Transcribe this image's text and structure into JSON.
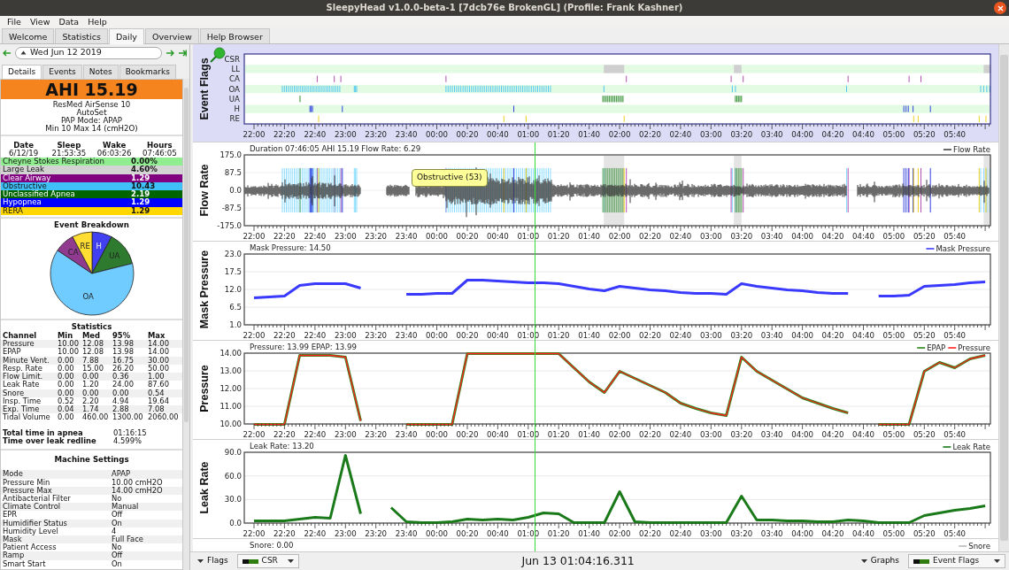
{
  "window": {
    "title": "SleepyHead v1.0.0-beta-1 [7dcb76e BrokenGL] (Profile: Frank Kashner)"
  },
  "menu": [
    "File",
    "View",
    "Data",
    "Help"
  ],
  "tabs": [
    {
      "label": "Welcome",
      "selected": false
    },
    {
      "label": "Statistics",
      "selected": false
    },
    {
      "label": "Daily",
      "selected": true
    },
    {
      "label": "Overview",
      "selected": false
    },
    {
      "label": "Help Browser",
      "selected": false
    }
  ],
  "day_nav": {
    "date": "Wed Jun 12 2019"
  },
  "detail_tabs": [
    {
      "label": "Details",
      "selected": true
    },
    {
      "label": "Events",
      "selected": false
    },
    {
      "label": "Notes",
      "selected": false
    },
    {
      "label": "Bookmarks",
      "selected": false
    }
  ],
  "summary": {
    "ahi": "AHI 15.19",
    "lines": [
      "ResMed AirSense 10",
      "AutoSet",
      "PAP Mode: APAP",
      "Min 10 Max 14 (cmH2O)"
    ]
  },
  "session": {
    "columns": [
      "Date",
      "Sleep",
      "Wake",
      "Hours"
    ],
    "values": [
      "6/12/19",
      "21:53:35",
      "06:03:26",
      "07:46:05"
    ]
  },
  "indices": [
    {
      "name": "Cheyne Stokes Respiration",
      "value": "0.00%",
      "color": "#90ee90"
    },
    {
      "name": "Large Leak",
      "value": "4.60%",
      "color": "#d3d3d3"
    },
    {
      "name": "Clear Airway",
      "value": "1.29",
      "color": "#800080"
    },
    {
      "name": "Obstructive",
      "value": "10.43",
      "color": "#40c0f8"
    },
    {
      "name": "Unclassified Apnea",
      "value": "2.19",
      "color": "#006400"
    },
    {
      "name": "Hypopnea",
      "value": "1.29",
      "color": "#0000ff"
    },
    {
      "name": "RERA",
      "value": "1.29",
      "color": "#ffd700"
    }
  ],
  "breakdown": {
    "title": "Event Breakdown",
    "slices": [
      {
        "label": "H",
        "color": "#4040f0"
      },
      {
        "label": "UA",
        "color": "#2e7a2e"
      },
      {
        "label": "OA",
        "color": "#70ccff"
      },
      {
        "label": "CA",
        "color": "#903a90"
      },
      {
        "label": "RE",
        "color": "#ffdd33"
      }
    ]
  },
  "statistics": {
    "title": "Statistics",
    "columns": [
      "Channel",
      "Min",
      "Med",
      "95%",
      "Max"
    ],
    "rows": [
      [
        "Pressure",
        "10.00",
        "12.08",
        "13.98",
        "14.00"
      ],
      [
        "EPAP",
        "10.00",
        "12.08",
        "13.98",
        "14.00"
      ],
      [
        "Minute Vent.",
        "0.00",
        "7.88",
        "16.75",
        "30.00"
      ],
      [
        "Resp. Rate",
        "0.00",
        "15.00",
        "26.20",
        "50.00"
      ],
      [
        "Flow Limit.",
        "0.00",
        "0.00",
        "0.36",
        "1.00"
      ],
      [
        "Leak Rate",
        "0.00",
        "1.20",
        "24.00",
        "87.60"
      ],
      [
        "Snore",
        "0.00",
        "0.00",
        "0.00",
        "0.54"
      ],
      [
        "Insp. Time",
        "0.52",
        "2.20",
        "4.94",
        "19.64"
      ],
      [
        "Exp. Time",
        "0.04",
        "1.74",
        "2.88",
        "7.08"
      ],
      [
        "Tidal Volume",
        "0.00",
        "460.00",
        "1300.00",
        "2060.00"
      ]
    ]
  },
  "totals": [
    {
      "label": "Total time in apnea",
      "value": "01:16:15"
    },
    {
      "label": "Time over leak redline",
      "value": "4.599%"
    }
  ],
  "machine_settings": {
    "title": "Machine Settings",
    "rows": [
      [
        "Mode",
        "APAP"
      ],
      [
        "Pressure Min",
        "10.00 cmH2O"
      ],
      [
        "Pressure Max",
        "14.00 cmH2O"
      ],
      [
        "Antibacterial Filter",
        "No"
      ],
      [
        "Climate Control",
        "Manual"
      ],
      [
        "EPR",
        "Off"
      ],
      [
        "Humidifier Status",
        "On"
      ],
      [
        "Humidity Level",
        "4"
      ],
      [
        "Mask",
        "Full Face"
      ],
      [
        "Patient Access",
        "No"
      ],
      [
        "Ramp",
        "Off"
      ],
      [
        "Smart Start",
        "On"
      ]
    ]
  },
  "graphs": [
    {
      "kind": "flags",
      "title": "Event Flags",
      "rows": [
        "CSR",
        "LL",
        "CA",
        "OA",
        "UA",
        "H",
        "RE"
      ],
      "time_ticks": [
        "22:00",
        "22:20",
        "22:40",
        "23:00",
        "23:20",
        "23:40",
        "00:00",
        "00:20",
        "00:40",
        "01:00",
        "01:20",
        "01:40",
        "02:00",
        "02:20",
        "02:40",
        "03:00",
        "03:20",
        "03:40",
        "04:00",
        "04:20",
        "04:40",
        "05:00",
        "05:20",
        "05:40"
      ]
    },
    {
      "kind": "waveform",
      "title": "Flow Rate",
      "readout": "Duration 07:46:05 AHI 15.19 Flow Rate: 6.29",
      "legend": [
        "Flow Rate"
      ],
      "tooltip": "Obstructive (53)",
      "y_labels": [
        "175.0",
        "87.5",
        "0.0",
        "-87.5",
        "-175.0"
      ],
      "time_ticks": [
        "22:00",
        "22:20",
        "22:40",
        "23:00",
        "23:20",
        "23:40",
        "00:00",
        "00:20",
        "00:40",
        "01:00",
        "01:20",
        "01:40",
        "02:00",
        "02:20",
        "02:40",
        "03:00",
        "03:20",
        "03:40",
        "04:00",
        "04:20",
        "04:40",
        "05:00",
        "05:20",
        "05:40"
      ]
    },
    {
      "kind": "line",
      "readout": "Mask Pressure: 14.50",
      "chart_data": {
        "type": "line",
        "ylabel": "Mask Pressure",
        "ylim": [
          1,
          23
        ],
        "grid": true,
        "legend": "upper right",
        "yticks": [
          {
            "value": 1,
            "label": "1.0"
          },
          {
            "value": 6.5,
            "label": "6.5"
          },
          {
            "value": 12,
            "label": "12.0"
          },
          {
            "value": 17.5,
            "label": "17.5"
          },
          {
            "value": 23,
            "label": "23.0"
          }
        ],
        "categories": [
          "22:00",
          null,
          "22:20",
          null,
          "22:40",
          null,
          "23:00",
          null,
          "23:20",
          null,
          "23:40",
          null,
          "00:00",
          null,
          "00:20",
          null,
          "00:40",
          null,
          "01:00",
          null,
          "01:20",
          null,
          "01:40",
          null,
          "02:00",
          null,
          "02:20",
          null,
          "02:40",
          null,
          "03:00",
          null,
          "03:20",
          null,
          "03:40",
          null,
          "04:00",
          null,
          "04:20",
          null,
          "04:40",
          null,
          "05:00",
          null,
          "05:20",
          null,
          "05:40",
          null,
          null
        ],
        "series": [
          {
            "name": "Mask Pressure",
            "color": "#3a3aff",
            "values": [
              9.5,
              9.8,
              10,
              13.5,
              13.8,
              14,
              13.8,
              12.5,
              null,
              null,
              10.5,
              10.6,
              10.8,
              11,
              15,
              15,
              14.8,
              14.5,
              14.3,
              14.3,
              14,
              13,
              12.3,
              11.8,
              13,
              12.5,
              12,
              11.6,
              11.2,
              11,
              10.8,
              10.6,
              14,
              13,
              12.5,
              12,
              11.6,
              11.3,
              11,
              10.8,
              null,
              10,
              10.2,
              10.3,
              13,
              13.5,
              13.6,
              14.2,
              14.5
            ]
          }
        ]
      }
    },
    {
      "kind": "line",
      "readout": "Pressure: 13.99 EPAP: 13.99",
      "chart_data": {
        "type": "line",
        "ylabel": "Pressure",
        "ylim": [
          10,
          14
        ],
        "grid": true,
        "legend": "upper right",
        "yticks": [
          {
            "value": 10,
            "label": "10.00"
          },
          {
            "value": 11,
            "label": "11.00"
          },
          {
            "value": 12,
            "label": "12.00"
          },
          {
            "value": 13,
            "label": "13.00"
          },
          {
            "value": 14,
            "label": "14.00"
          }
        ],
        "categories": [
          "22:00",
          null,
          "22:20",
          null,
          "22:40",
          null,
          "23:00",
          null,
          "23:20",
          null,
          "23:40",
          null,
          "00:00",
          null,
          "00:20",
          null,
          "00:40",
          null,
          "01:00",
          null,
          "01:20",
          null,
          "01:40",
          null,
          "02:00",
          null,
          "02:20",
          null,
          "02:40",
          null,
          "03:00",
          null,
          "03:20",
          null,
          "03:40",
          null,
          "04:00",
          null,
          "04:20",
          null,
          "04:40",
          null,
          "05:00",
          null,
          "05:20",
          null,
          "05:40",
          null,
          null
        ],
        "series": [
          {
            "name": "EPAP",
            "color": "#2a8a1a",
            "values": [
              10,
              10,
              10,
              13.9,
              13.9,
              13.9,
              13.8,
              10.2,
              null,
              null,
              10,
              10,
              10,
              10,
              14,
              14,
              14,
              14,
              14,
              14,
              14,
              13.2,
              12.4,
              11.8,
              13,
              12.6,
              12.2,
              11.8,
              11.2,
              10.9,
              10.65,
              10.5,
              13.8,
              13,
              12.5,
              12,
              11.5,
              11.2,
              10.9,
              10.65,
              null,
              10,
              10,
              10,
              13,
              13.5,
              13.2,
              13.7,
              13.9
            ]
          },
          {
            "name": "Pressure",
            "color": "#ff2020",
            "values": [
              10,
              10,
              10,
              13.9,
              13.9,
              13.9,
              13.8,
              10.2,
              null,
              null,
              10,
              10,
              10,
              10,
              14,
              14,
              14,
              14,
              14,
              14,
              14,
              13.2,
              12.4,
              11.8,
              13,
              12.6,
              12.2,
              11.8,
              11.2,
              10.9,
              10.65,
              10.5,
              13.8,
              13,
              12.5,
              12,
              11.5,
              11.2,
              10.9,
              10.65,
              null,
              10,
              10,
              10,
              13,
              13.5,
              13.2,
              13.7,
              13.9
            ]
          }
        ]
      }
    },
    {
      "kind": "line",
      "readout": "Leak Rate: 13.20",
      "chart_data": {
        "type": "line",
        "ylabel": "Leak Rate",
        "ylim": [
          0,
          90
        ],
        "grid": true,
        "legend": "upper right",
        "yticks": [
          {
            "value": 0,
            "label": "0.0"
          },
          {
            "value": 30,
            "label": "30.0"
          },
          {
            "value": 60,
            "label": "60.0"
          },
          {
            "value": 90,
            "label": "90.0"
          }
        ],
        "categories": [
          "22:00",
          null,
          "22:20",
          null,
          "22:40",
          null,
          "23:00",
          null,
          "23:20",
          null,
          "23:40",
          null,
          "00:00",
          null,
          "00:20",
          null,
          "00:40",
          null,
          "01:00",
          null,
          "01:20",
          null,
          "01:40",
          null,
          "02:00",
          null,
          "02:20",
          null,
          "02:40",
          null,
          "03:00",
          null,
          "03:20",
          null,
          "03:40",
          null,
          "04:00",
          null,
          "04:20",
          null,
          "04:40",
          null,
          "05:00",
          null,
          "05:20",
          null,
          "05:40",
          null,
          null
        ],
        "series": [
          {
            "name": "Leak Rate",
            "color": "#1a7a1a",
            "values": [
              3,
              3,
              3,
              6,
              8,
              7,
              87,
              12,
              null,
              20,
              2,
              1,
              1,
              2,
              6,
              5,
              6,
              4,
              8,
              14,
              12,
              1,
              1,
              1,
              40,
              2,
              1,
              1,
              1,
              1,
              1,
              1,
              35,
              5,
              4,
              3,
              3,
              2,
              2,
              5,
              3,
              1,
              1,
              1,
              10,
              14,
              17,
              19,
              22
            ]
          }
        ]
      }
    },
    {
      "kind": "strip",
      "readout": "Snore: 0.00",
      "legend": [
        "Snore"
      ]
    }
  ],
  "bottom_bar": {
    "flags_button": "Flags",
    "flag_select": "CSR",
    "position": "Jun 13 01:04:16.311",
    "graphs_button": "Graphs",
    "graph_select": "Event Flags"
  }
}
